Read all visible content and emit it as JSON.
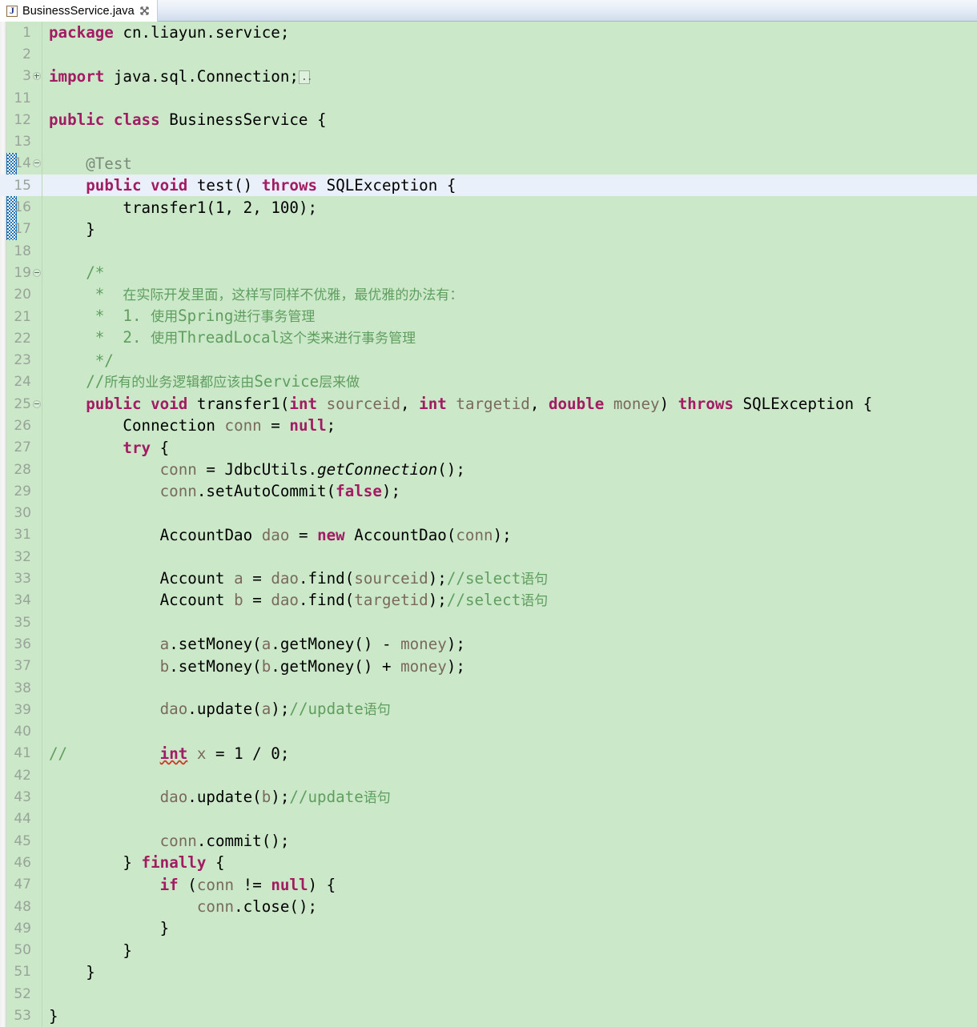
{
  "window": {
    "kind": "eclipse-java-editor"
  },
  "tab": {
    "icon": "java-file-icon",
    "label": "BusinessService.java",
    "close_icon": "close-icon",
    "close_label": "✖"
  },
  "editor": {
    "background_color": "#cbe8c9",
    "current_line_color": "#e9f0fa",
    "line_number_color": "#9aa39a",
    "keyword_color": "#a21b63",
    "comment_color": "#5f9e5f",
    "parameter_color": "#7d6b52",
    "error_underline_color": "#d03a2a",
    "change_bar_color": "#1f72b5",
    "current_line": 15,
    "change_bar_lines": [
      14,
      15,
      16,
      17
    ],
    "first_line": 1,
    "last_line": 53
  },
  "lines": [
    {
      "n": "1",
      "fold": "",
      "text": "package cn.liayun.service;"
    },
    {
      "n": "2",
      "fold": "",
      "text": ""
    },
    {
      "n": "3",
      "fold": "plus",
      "text": "import java.sql.Connection;"
    },
    {
      "n": "11",
      "fold": "",
      "text": ""
    },
    {
      "n": "12",
      "fold": "",
      "text": "public class BusinessService {"
    },
    {
      "n": "13",
      "fold": "",
      "text": ""
    },
    {
      "n": "14",
      "fold": "minus",
      "text": "    @Test"
    },
    {
      "n": "15",
      "fold": "",
      "text": "    public void test() throws SQLException {"
    },
    {
      "n": "16",
      "fold": "",
      "text": "        transfer1(1, 2, 100);"
    },
    {
      "n": "17",
      "fold": "",
      "text": "    }"
    },
    {
      "n": "18",
      "fold": "",
      "text": ""
    },
    {
      "n": "19",
      "fold": "minus",
      "text": "    /*"
    },
    {
      "n": "20",
      "fold": "",
      "text": "     *  在实际开发里面，这样写同样不优雅，最优雅的办法有："
    },
    {
      "n": "21",
      "fold": "",
      "text": "     *  1. 使用Spring进行事务管理"
    },
    {
      "n": "22",
      "fold": "",
      "text": "     *  2. 使用ThreadLocal这个类来进行事务管理"
    },
    {
      "n": "23",
      "fold": "",
      "text": "     */"
    },
    {
      "n": "24",
      "fold": "",
      "text": "    //所有的业务逻辑都应该由Service层来做"
    },
    {
      "n": "25",
      "fold": "minus",
      "text": "    public void transfer1(int sourceid, int targetid, double money) throws SQLException {"
    },
    {
      "n": "26",
      "fold": "",
      "text": "        Connection conn = null;"
    },
    {
      "n": "27",
      "fold": "",
      "text": "        try {"
    },
    {
      "n": "28",
      "fold": "",
      "text": "            conn = JdbcUtils.getConnection();"
    },
    {
      "n": "29",
      "fold": "",
      "text": "            conn.setAutoCommit(false);"
    },
    {
      "n": "30",
      "fold": "",
      "text": ""
    },
    {
      "n": "31",
      "fold": "",
      "text": "            AccountDao dao = new AccountDao(conn);"
    },
    {
      "n": "32",
      "fold": "",
      "text": ""
    },
    {
      "n": "33",
      "fold": "",
      "text": "            Account a = dao.find(sourceid);//select语句"
    },
    {
      "n": "34",
      "fold": "",
      "text": "            Account b = dao.find(targetid);//select语句"
    },
    {
      "n": "35",
      "fold": "",
      "text": ""
    },
    {
      "n": "36",
      "fold": "",
      "text": "            a.setMoney(a.getMoney() - money);"
    },
    {
      "n": "37",
      "fold": "",
      "text": "            b.setMoney(b.getMoney() + money);"
    },
    {
      "n": "38",
      "fold": "",
      "text": ""
    },
    {
      "n": "39",
      "fold": "",
      "text": "            dao.update(a);//update语句"
    },
    {
      "n": "40",
      "fold": "",
      "text": ""
    },
    {
      "n": "41",
      "fold": "",
      "text": "//          int x = 1 / 0;"
    },
    {
      "n": "42",
      "fold": "",
      "text": ""
    },
    {
      "n": "43",
      "fold": "",
      "text": "            dao.update(b);//update语句"
    },
    {
      "n": "44",
      "fold": "",
      "text": ""
    },
    {
      "n": "45",
      "fold": "",
      "text": "            conn.commit();"
    },
    {
      "n": "46",
      "fold": "",
      "text": "        } finally {"
    },
    {
      "n": "47",
      "fold": "",
      "text": "            if (conn != null) {"
    },
    {
      "n": "48",
      "fold": "",
      "text": "                conn.close();"
    },
    {
      "n": "49",
      "fold": "",
      "text": "            }"
    },
    {
      "n": "50",
      "fold": "",
      "text": "        }"
    },
    {
      "n": "51",
      "fold": "",
      "text": "    }"
    },
    {
      "n": "52",
      "fold": "",
      "text": ""
    },
    {
      "n": "53",
      "fold": "",
      "text": "}"
    }
  ],
  "tokens": {
    "l1": [
      {
        "t": "package",
        "c": "kw"
      },
      {
        "t": " cn.liayun.service;",
        "c": "plain"
      }
    ],
    "l3": [
      {
        "t": "import",
        "c": "kw"
      },
      {
        "t": " java.sql.Connection;",
        "c": "plain"
      },
      {
        "t": "FOLDBOX",
        "c": "foldbox"
      }
    ],
    "l12": [
      {
        "t": "public",
        "c": "kw"
      },
      {
        "t": " ",
        "c": "plain"
      },
      {
        "t": "class",
        "c": "kw"
      },
      {
        "t": " BusinessService {",
        "c": "plain"
      }
    ],
    "l14": [
      {
        "t": "    @Test",
        "c": "ann"
      }
    ],
    "l15": [
      {
        "t": "    ",
        "c": "plain"
      },
      {
        "t": "public",
        "c": "kw"
      },
      {
        "t": " ",
        "c": "plain"
      },
      {
        "t": "void",
        "c": "kw"
      },
      {
        "t": " test() ",
        "c": "plain"
      },
      {
        "t": "throws",
        "c": "kw"
      },
      {
        "t": " SQLException {",
        "c": "plain"
      }
    ],
    "l16": [
      {
        "t": "        transfer1(1, 2, 100);",
        "c": "plain"
      }
    ],
    "l17": [
      {
        "t": "    }",
        "c": "plain"
      }
    ],
    "l19": [
      {
        "t": "    /*",
        "c": "cmt"
      }
    ],
    "l25": [
      {
        "t": "    ",
        "c": "plain"
      },
      {
        "t": "public",
        "c": "kw"
      },
      {
        "t": " ",
        "c": "plain"
      },
      {
        "t": "void",
        "c": "kw"
      },
      {
        "t": " transfer1(",
        "c": "plain"
      },
      {
        "t": "int",
        "c": "kw"
      },
      {
        "t": " sourceid",
        "c": "param"
      },
      {
        "t": ", ",
        "c": "plain"
      },
      {
        "t": "int",
        "c": "kw"
      },
      {
        "t": " targetid",
        "c": "param"
      },
      {
        "t": ", ",
        "c": "plain"
      },
      {
        "t": "double",
        "c": "kw"
      },
      {
        "t": " money",
        "c": "param"
      },
      {
        "t": ") ",
        "c": "plain"
      },
      {
        "t": "throws",
        "c": "kw"
      },
      {
        "t": " SQLException {",
        "c": "plain"
      }
    ]
  }
}
